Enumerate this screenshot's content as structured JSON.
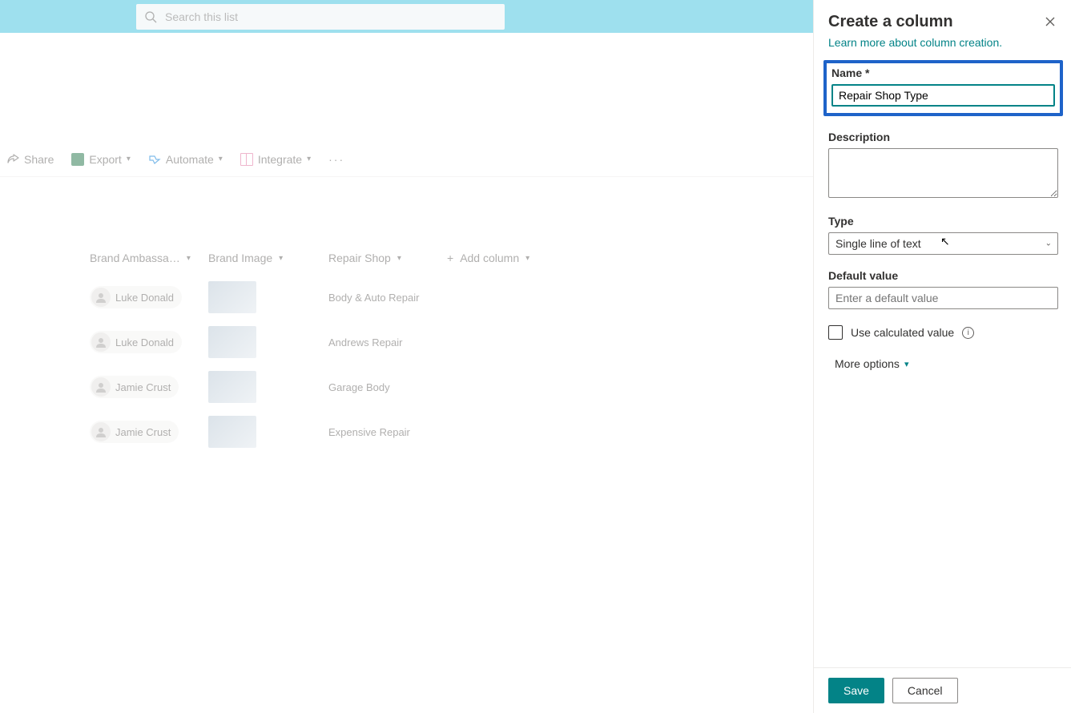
{
  "search": {
    "placeholder": "Search this list"
  },
  "commands": {
    "share": "Share",
    "export": "Export",
    "automate": "Automate",
    "integrate": "Integrate"
  },
  "columns": {
    "brand_ambassador": "Brand Ambassa…",
    "brand_image": "Brand Image",
    "repair_shop": "Repair Shop",
    "add_column": "Add column"
  },
  "rows": [
    {
      "ambassador": "Luke Donald",
      "repair_shop": "Body & Auto Repair"
    },
    {
      "ambassador": "Luke Donald",
      "repair_shop": "Andrews Repair"
    },
    {
      "ambassador": "Jamie Crust",
      "repair_shop": "Garage Body"
    },
    {
      "ambassador": "Jamie Crust",
      "repair_shop": "Expensive Repair"
    }
  ],
  "panel": {
    "title": "Create a column",
    "learn_more": "Learn more about column creation.",
    "name_label": "Name *",
    "name_value": "Repair Shop Type",
    "description_label": "Description",
    "description_value": "",
    "type_label": "Type",
    "type_value": "Single line of text",
    "default_label": "Default value",
    "default_placeholder": "Enter a default value",
    "calculated_label": "Use calculated value",
    "more_options": "More options",
    "save": "Save",
    "cancel": "Cancel"
  }
}
